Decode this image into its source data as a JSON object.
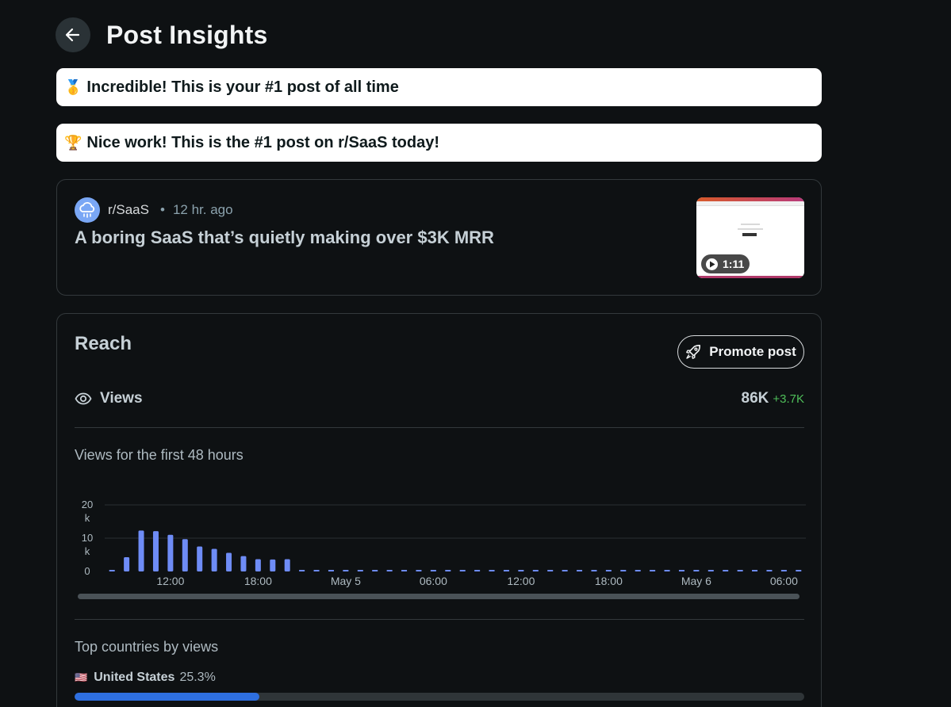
{
  "header": {
    "title": "Post Insights"
  },
  "banners": [
    {
      "icon": "medal-icon",
      "emoji": "🥇",
      "text": "Incredible! This is your #1 post of all time"
    },
    {
      "icon": "trophy-icon",
      "emoji": "🏆",
      "text": "Nice work! This is the #1 post on r/SaaS today!"
    }
  ],
  "post": {
    "subreddit": "r/SaaS",
    "separator": "•",
    "age": "12 hr. ago",
    "title": "A boring SaaS that’s quietly making over $3K MRR",
    "video_duration": "1:11"
  },
  "reach": {
    "title": "Reach",
    "promote_label": "Promote post",
    "views_label": "Views",
    "views_total": "86K",
    "views_delta": "+3.7K",
    "chart_title": "Views for the first 48 hours"
  },
  "chart_data": {
    "type": "bar",
    "title": "Views for the first 48 hours",
    "y_ticks": [
      "20\nk",
      "10\nk",
      "0"
    ],
    "ylim": [
      0,
      20000
    ],
    "x_ticks": [
      "12:00",
      "18:00",
      "May 5",
      "06:00",
      "12:00",
      "18:00",
      "May 6",
      "06:00"
    ],
    "grid": true,
    "values": [
      0,
      4300,
      12300,
      12100,
      11000,
      9700,
      7500,
      6800,
      5600,
      4600,
      3700,
      3600,
      3700,
      0,
      0,
      0,
      0,
      0,
      0,
      0,
      0,
      0,
      0,
      0,
      0,
      0,
      0,
      0,
      0,
      0,
      0,
      0,
      0,
      0,
      0,
      0,
      0,
      0,
      0,
      0,
      0,
      0,
      0,
      0,
      0,
      0,
      0,
      0
    ],
    "bar_color": "#6e8cf6"
  },
  "countries": {
    "title": "Top countries by views",
    "items": [
      {
        "flag": "🇺🇸",
        "name": "United States",
        "percent_label": "25.3%",
        "fraction": 0.253
      }
    ]
  },
  "colors": {
    "accent": "#2e6fe0",
    "positive": "#4fbf5a",
    "background": "#0e1113"
  }
}
